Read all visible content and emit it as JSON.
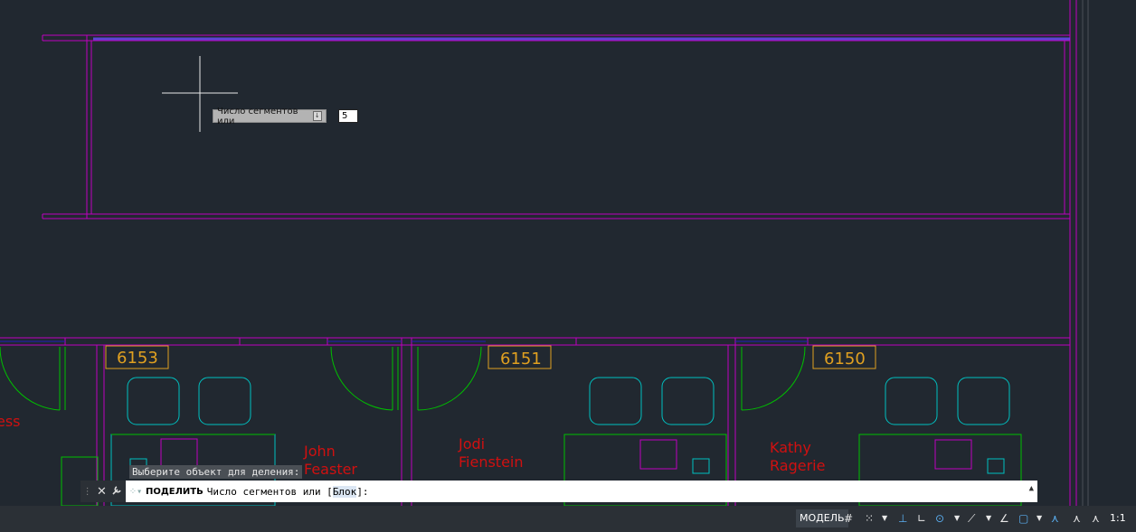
{
  "tooltip": {
    "label": "Число сегментов или",
    "arrow": "↓",
    "input_value": "5"
  },
  "command_history": "Выберите объект для деления:",
  "command_line": {
    "command": "ПОДЕЛИТЬ",
    "prompt": "Число сегментов или [",
    "option": "Блок",
    "suffix": "]:",
    "close_icon": "✕",
    "settings_icon": "🔧",
    "caret": "▲"
  },
  "rooms": [
    {
      "number": "6153",
      "occupant_line1": "John",
      "occupant_line2": "Feaster"
    },
    {
      "number": "6151",
      "occupant_line1": "Jodi",
      "occupant_line2": "Fienstein"
    },
    {
      "number": "6150",
      "occupant_line1": "Kathy",
      "occupant_line2": "Ragerie"
    }
  ],
  "partial_label": "ess",
  "status_bar": {
    "model_label": "МОДЕЛЬ",
    "scale_label": "1:1"
  },
  "colors": {
    "background": "#212830",
    "walls": "#c000c0",
    "doors": "#00c000",
    "furniture": "#00c0c0",
    "room_tags": "#e0a020",
    "names": "#d01010",
    "windows": "#2020c0"
  }
}
